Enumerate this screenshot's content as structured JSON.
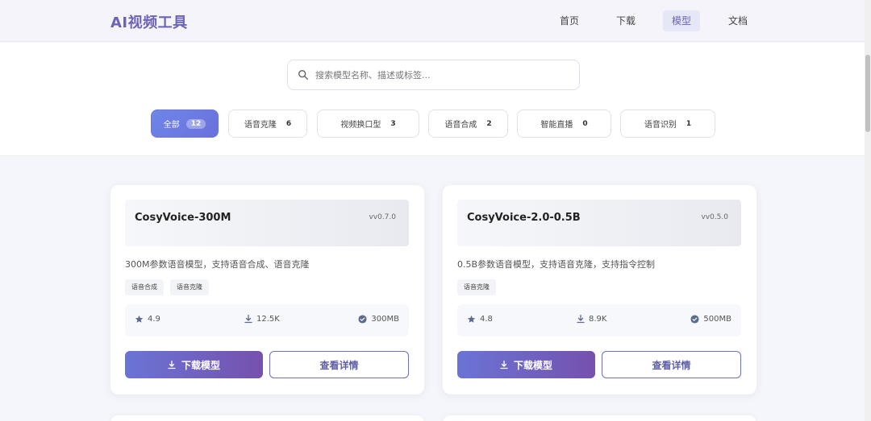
{
  "header": {
    "logo": "AI视频工具",
    "nav": [
      {
        "label": "首页",
        "active": false
      },
      {
        "label": "下载",
        "active": false
      },
      {
        "label": "模型",
        "active": true
      },
      {
        "label": "文档",
        "active": false
      }
    ]
  },
  "search": {
    "placeholder": "搜索模型名称、描述或标签...",
    "value": ""
  },
  "filters": [
    {
      "label": "全部",
      "count": "12",
      "active": true
    },
    {
      "label": "语音克隆",
      "count": "6",
      "active": false
    },
    {
      "label": "视频换口型",
      "count": "3",
      "active": false
    },
    {
      "label": "语音合成",
      "count": "2",
      "active": false
    },
    {
      "label": "智能直播",
      "count": "0",
      "active": false
    },
    {
      "label": "语音识别",
      "count": "1",
      "active": false
    }
  ],
  "models": [
    {
      "name": "CosyVoice-300M",
      "version": "vv0.7.0",
      "description": "300M参数语音模型，支持语音合成、语音克隆",
      "tags": [
        "语音合成",
        "语音克隆"
      ],
      "rating": "4.9",
      "downloads": "12.5K",
      "size": "300MB",
      "download_label": "下载模型",
      "details_label": "查看详情"
    },
    {
      "name": "CosyVoice-2.0-0.5B",
      "version": "vv0.5.0",
      "description": "0.5B参数语音模型，支持语音克隆，支持指令控制",
      "tags": [
        "语音克隆"
      ],
      "rating": "4.8",
      "downloads": "8.9K",
      "size": "500MB",
      "download_label": "下载模型",
      "details_label": "查看详情"
    }
  ],
  "colors": {
    "brand": "#6b63b5",
    "accent": "#6a70dc",
    "primary_button": "#7651ad"
  }
}
